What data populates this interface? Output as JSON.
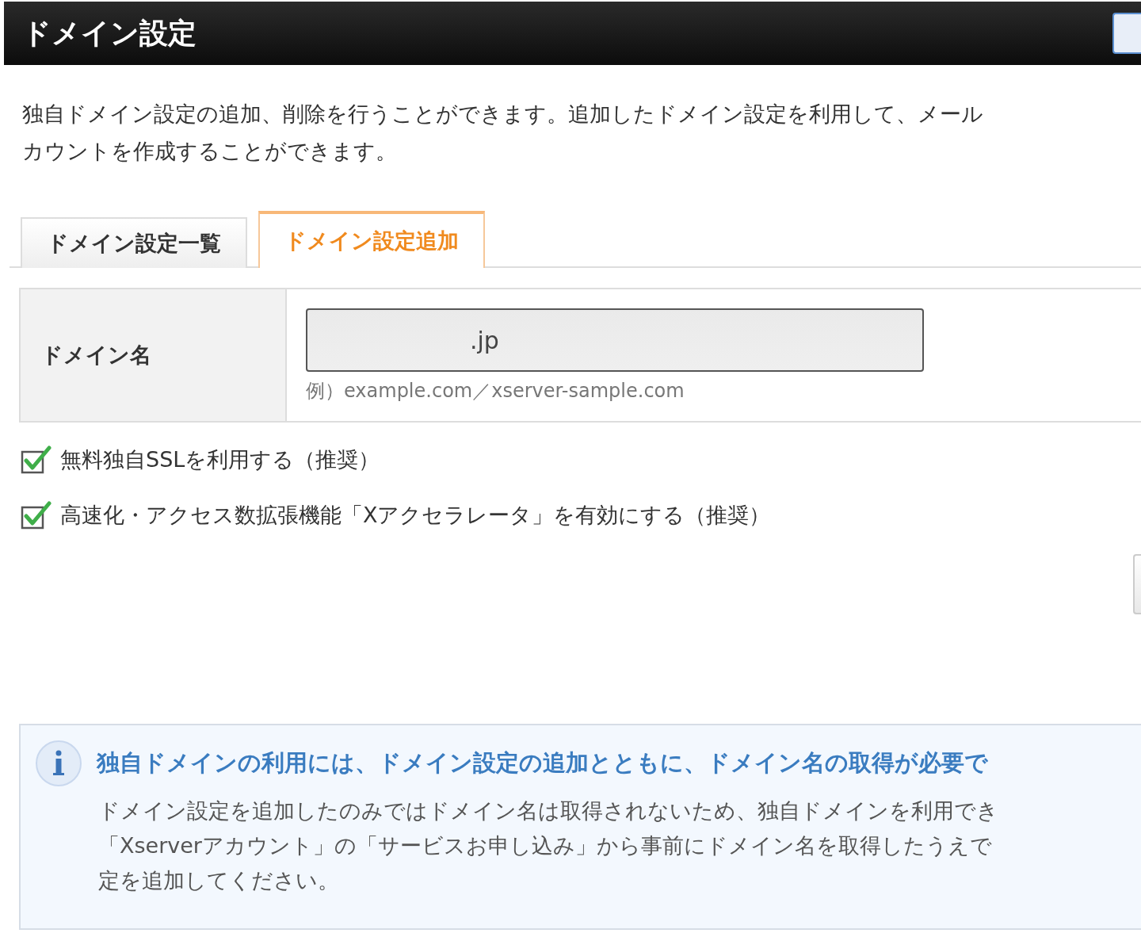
{
  "header": {
    "title": "ドメイン設定"
  },
  "description": [
    "独自ドメイン設定の追加、削除を行うことができます。追加したドメイン設定を利用して、メール",
    "カウントを作成することができます。"
  ],
  "tabs": [
    {
      "label": "ドメイン設定一覧",
      "selected": false
    },
    {
      "label": "ドメイン設定追加",
      "selected": true
    }
  ],
  "form": {
    "label": "ドメイン名",
    "value": ".jp",
    "hint": "例）example.com／xserver-sample.com"
  },
  "options": [
    {
      "label": "無料独自SSLを利用する（推奨）",
      "checked": true
    },
    {
      "label": "高速化・アクセス数拡張機能「Xアクセラレータ」を有効にする（推奨）",
      "checked": true
    }
  ],
  "notice": {
    "title": "独自ドメインの利用には、ドメイン設定の追加とともに、ドメイン名の取得が必要で",
    "body": [
      "ドメイン設定を追加したのみではドメイン名は取得されないため、独自ドメインを利用でき",
      "「Xserverアカウント」の「サービスお申し込み」から事前にドメイン名を取得したうえで",
      "定を追加してください。"
    ]
  }
}
